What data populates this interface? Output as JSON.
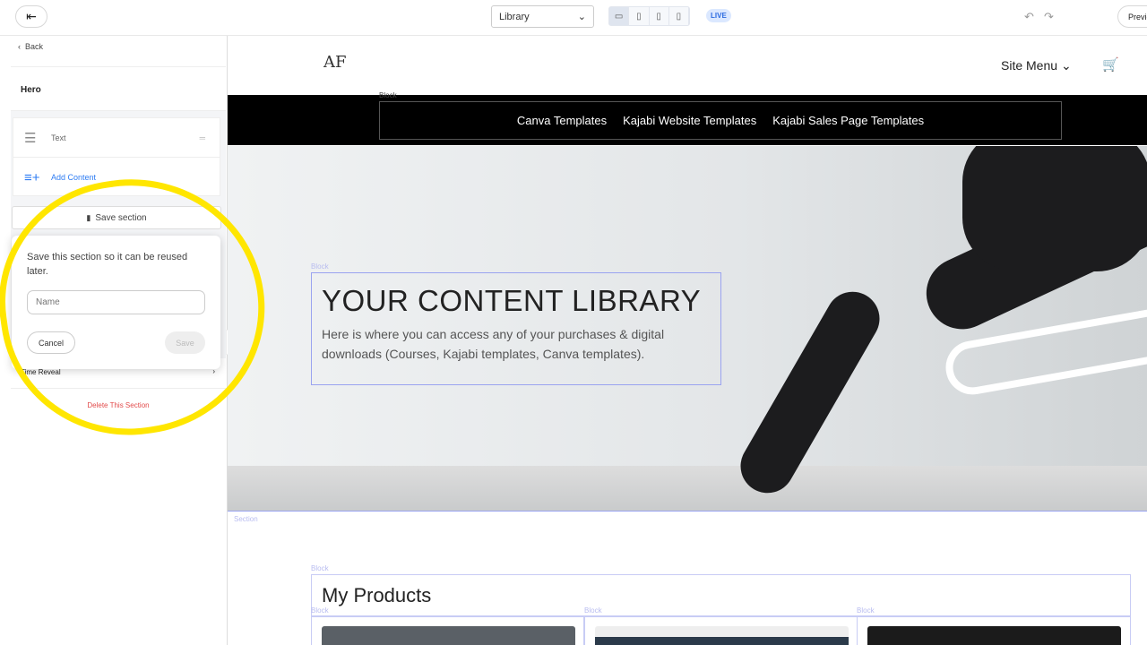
{
  "topbar": {
    "page_select": "Library",
    "live_badge": "LIVE",
    "preview_label": "Preview",
    "devices": [
      "desktop",
      "tablet-landscape",
      "tablet",
      "mobile"
    ]
  },
  "sidebar": {
    "back_label": "Back",
    "section_title": "Hero",
    "items": [
      {
        "label": "Text",
        "icon": "text-icon"
      },
      {
        "label": "Add Content",
        "icon": "add-list-icon"
      }
    ],
    "save_section_label": "Save section",
    "time_reveal_label": "Time Reveal",
    "delete_label": "Delete This Section"
  },
  "save_popup": {
    "message": "Save this section so it can be reused later.",
    "name_placeholder": "Name",
    "cancel_label": "Cancel",
    "save_label": "Save"
  },
  "site": {
    "logo": "AF",
    "site_menu_label": "Site Menu",
    "nav_links": [
      "Canva Templates",
      "Kajabi Website Templates",
      "Kajabi Sales Page Templates"
    ],
    "hero_title": "YOUR CONTENT LIBRARY",
    "hero_text": "Here is where you can access any of your purchases & digital downloads (Courses, Kajabi templates, Canva templates).",
    "products_title": "My Products",
    "section_label": "Section",
    "block_label": "Block"
  },
  "colors": {
    "accent": "#2f7df3",
    "delete": "#e24b4b",
    "highlight": "#ffe600",
    "outline": "#9aa3f0"
  }
}
